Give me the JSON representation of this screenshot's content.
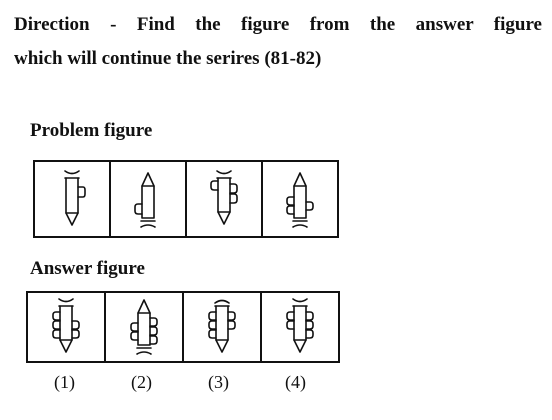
{
  "direction": {
    "line1": "Direction - Find the figure from the answer figure",
    "line2": "which will continue the serires (81-82)"
  },
  "problem_section": {
    "label": "Problem figure"
  },
  "answer_section": {
    "label": "Answer figure",
    "options": [
      "(1)",
      "(2)",
      "(3)",
      "(4)"
    ]
  }
}
